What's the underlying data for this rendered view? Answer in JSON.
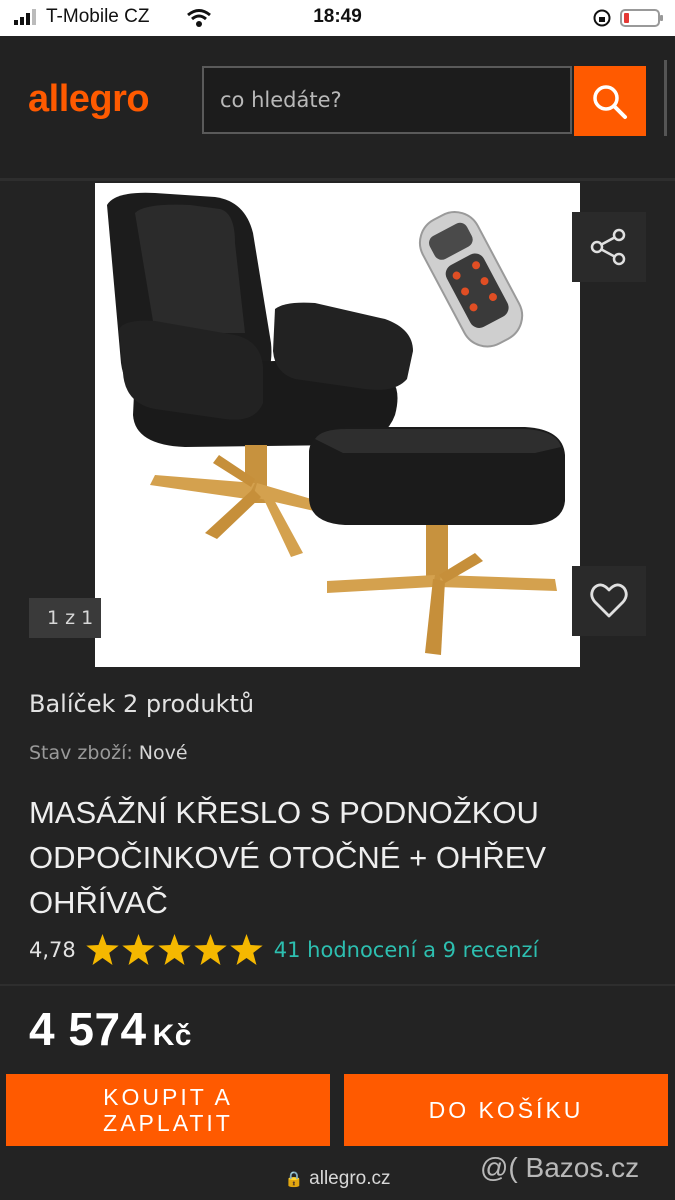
{
  "status_bar": {
    "carrier": "T-Mobile CZ",
    "time": "18:49"
  },
  "header": {
    "logo": "allegro",
    "search_placeholder": "co hledáte?"
  },
  "gallery": {
    "counter": "1 z 1"
  },
  "product": {
    "bundle": "Balíček 2 produktů",
    "condition_label": "Stav zboží:",
    "condition_value": "Nové",
    "title": "MASÁŽNÍ KŘESLO S PODNOŽKOU ODPOČINKOVÉ OTOČNÉ + OHŘEV OHŘÍVAČ",
    "rating": "4,78",
    "stars": 5,
    "reviews": "41 hodnocení a 9 recenzí",
    "price": "4 574",
    "currency": "Kč"
  },
  "actions": {
    "buy_label": "KOUPIT A ZAPLATIT",
    "cart_label": "DO KOŠÍKU"
  },
  "footer": {
    "url": "allegro.cz",
    "watermark": "@( Bazos.cz"
  },
  "colors": {
    "accent": "#ff5a00",
    "star": "#f5b800",
    "link": "#2dbfb0",
    "background": "#232323"
  }
}
